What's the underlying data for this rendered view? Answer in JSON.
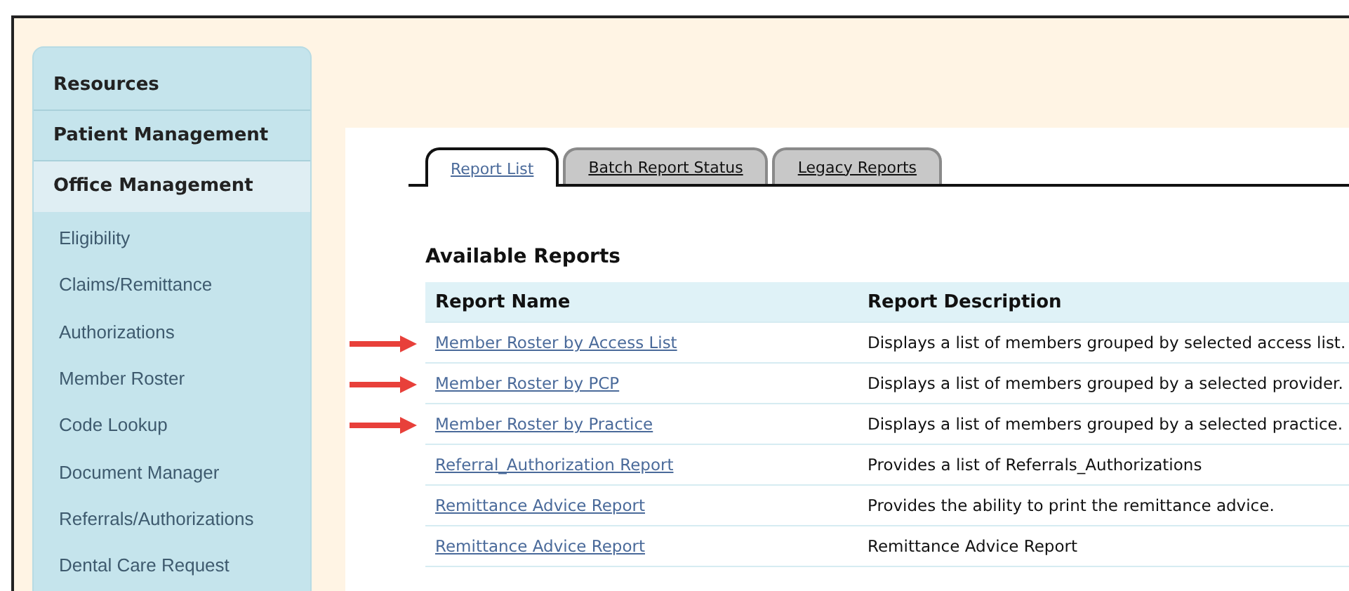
{
  "sidebar": {
    "sections": [
      {
        "label": "Resources",
        "selected": false
      },
      {
        "label": "Patient Management",
        "selected": false
      },
      {
        "label": "Office Management",
        "selected": true
      }
    ],
    "items": [
      "Eligibility",
      "Claims/Remittance",
      "Authorizations",
      "Member Roster",
      "Code Lookup",
      "Document Manager",
      "Referrals/Authorizations",
      "Dental Care Request"
    ]
  },
  "tabs": [
    {
      "label": "Report List",
      "selected": true
    },
    {
      "label": "Batch Report Status",
      "selected": false
    },
    {
      "label": "Legacy Reports",
      "selected": false
    }
  ],
  "heading": "Available Reports",
  "table": {
    "columns": [
      "Report Name",
      "Report Description"
    ],
    "rows": [
      {
        "name": "Member Roster by Access List",
        "description": "Displays a list of members grouped by selected access list.",
        "arrow": true
      },
      {
        "name": "Member Roster by PCP",
        "description": "Displays a list of members grouped by a selected provider.",
        "arrow": true
      },
      {
        "name": "Member Roster by Practice",
        "description": "Displays a list of members grouped by a selected practice.",
        "arrow": true
      },
      {
        "name": "Referral_Authorization Report",
        "description": "Provides a list of Referrals_Authorizations",
        "arrow": false
      },
      {
        "name": "Remittance Advice Report",
        "description": "Provides the ability to print the remittance advice.",
        "arrow": false
      },
      {
        "name": "Remittance Advice Report",
        "description": "Remittance Advice Report",
        "arrow": false
      }
    ]
  }
}
